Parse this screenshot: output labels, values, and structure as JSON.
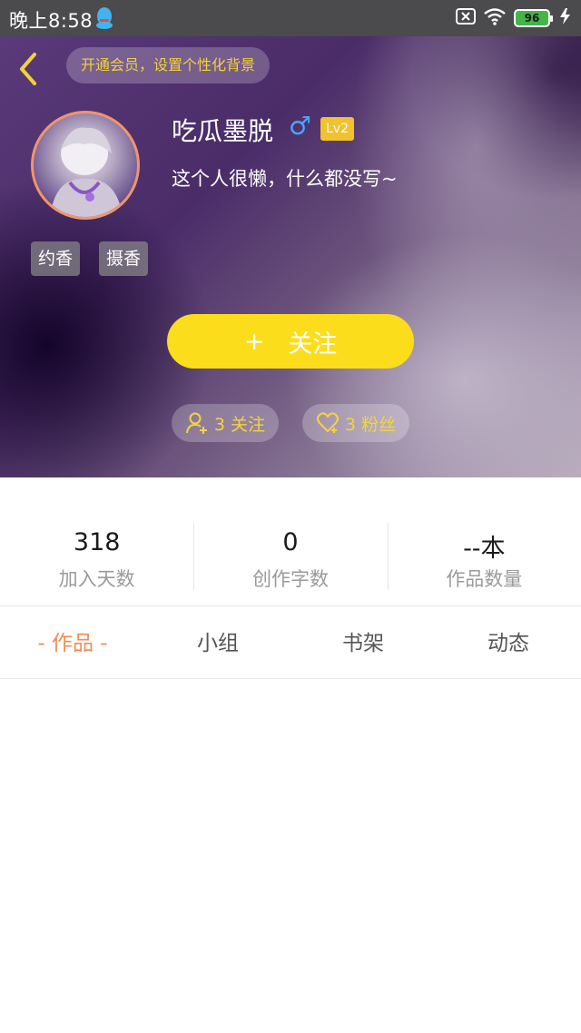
{
  "status_bar": {
    "time": "晚上8:58",
    "battery": "96"
  },
  "header": {
    "vip_prompt": "开通会员，设置个性化背景",
    "nickname": "吃瓜墨脱",
    "gender_symbol": "♂",
    "level": "Lv2",
    "bio": "这个人很懒，什么都没写~",
    "tags": [
      "约香",
      "摄香"
    ],
    "follow_button": {
      "plus": "+",
      "label": "关注"
    },
    "following_count": "3 关注",
    "fans_count": "3 粉丝"
  },
  "stats": [
    {
      "value": "318",
      "label": "加入天数"
    },
    {
      "value": "0",
      "label": "创作字数"
    },
    {
      "value": "--本",
      "label": "作品数量"
    }
  ],
  "tabs": [
    {
      "label": "- 作品 -",
      "active": true
    },
    {
      "label": "小组",
      "active": false
    },
    {
      "label": "书架",
      "active": false
    },
    {
      "label": "动态",
      "active": false
    }
  ],
  "colors": {
    "accent_yellow": "#fbdd1c",
    "active_tab": "#ef8d54",
    "gender_blue": "#4aa3ff"
  },
  "icons": {
    "back": "chevron-left-icon",
    "follow_person": "person-add-icon",
    "fans": "heart-icon"
  }
}
